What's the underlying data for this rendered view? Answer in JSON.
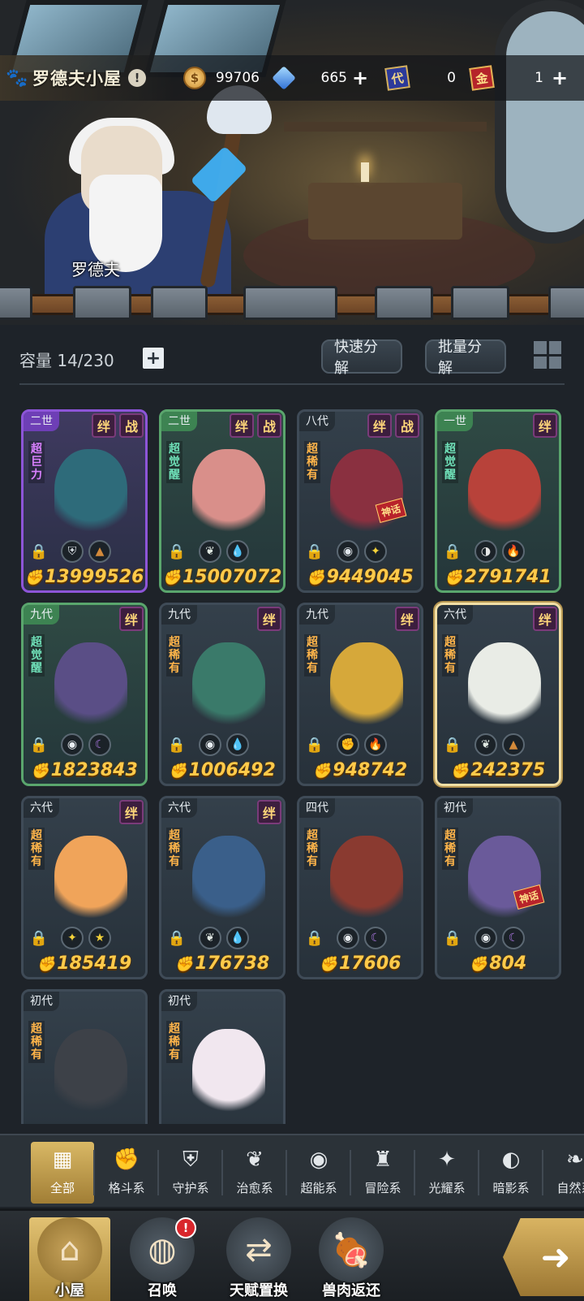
{
  "header": {
    "title": "罗德夫小屋",
    "npc_name": "罗德夫",
    "resources": [
      {
        "icon": "coin-icon",
        "value": "99706",
        "has_plus": false
      },
      {
        "icon": "crystal-icon",
        "value": "665",
        "has_plus": true
      },
      {
        "icon": "ticket-blue-icon",
        "glyph": "代",
        "value": "0",
        "has_plus": false
      },
      {
        "icon": "ticket-red-icon",
        "glyph": "金",
        "value": "1",
        "has_plus": true
      }
    ]
  },
  "inventory": {
    "capacity_label": "容量 14/230",
    "quick_decompose": "快速分解",
    "batch_decompose": "批量分解"
  },
  "cards": [
    {
      "gen": "二世",
      "rarity": "超巨力",
      "tags": [
        "绊",
        "战"
      ],
      "power": "13999526",
      "style": "purple",
      "elements": [
        "shield",
        "mountain"
      ],
      "color": "#2e6b7a"
    },
    {
      "gen": "二世",
      "rarity": "超觉醒",
      "tags": [
        "绊",
        "战"
      ],
      "power": "15007072",
      "style": "green",
      "elements": [
        "leaf",
        "water"
      ],
      "color": "#d98f8a"
    },
    {
      "gen": "八代",
      "rarity": "超稀有",
      "tags": [
        "绊",
        "战"
      ],
      "power": "9449045",
      "style": "normal",
      "elements": [
        "psychic",
        "light"
      ],
      "color": "#8a3040",
      "chip": "神话"
    },
    {
      "gen": "一世",
      "rarity": "超觉醒",
      "tags": [
        "绊"
      ],
      "power": "2791741",
      "style": "green",
      "elements": [
        "dark",
        "fire"
      ],
      "color": "#b8423a"
    },
    {
      "gen": "九代",
      "rarity": "超觉醒",
      "tags": [
        "绊"
      ],
      "power": "1823843",
      "style": "green",
      "elements": [
        "eye",
        "moon"
      ],
      "color": "#5a4e86"
    },
    {
      "gen": "九代",
      "rarity": "超稀有",
      "tags": [
        "绊"
      ],
      "power": "1006492",
      "style": "normal",
      "elements": [
        "eye",
        "water"
      ],
      "color": "#3a7a6a"
    },
    {
      "gen": "九代",
      "rarity": "超稀有",
      "tags": [
        "绊"
      ],
      "power": "948742",
      "style": "normal",
      "elements": [
        "fist",
        "fire"
      ],
      "color": "#d6a83a"
    },
    {
      "gen": "六代",
      "rarity": "超稀有",
      "tags": [
        "绊"
      ],
      "power": "242375",
      "style": "selected",
      "elements": [
        "leaf",
        "mountain"
      ],
      "color": "#e9ece6"
    },
    {
      "gen": "六代",
      "rarity": "超稀有",
      "tags": [
        "绊"
      ],
      "power": "185419",
      "style": "normal",
      "elements": [
        "light",
        "star"
      ],
      "color": "#f0a45a"
    },
    {
      "gen": "六代",
      "rarity": "超稀有",
      "tags": [
        "绊"
      ],
      "power": "176738",
      "style": "normal",
      "elements": [
        "leaf",
        "water"
      ],
      "color": "#3a5f8a"
    },
    {
      "gen": "四代",
      "rarity": "超稀有",
      "tags": [],
      "power": "17606",
      "style": "normal",
      "elements": [
        "eye",
        "moon"
      ],
      "color": "#8a3a30"
    },
    {
      "gen": "初代",
      "rarity": "超稀有",
      "tags": [],
      "power": "804",
      "style": "normal",
      "elements": [
        "eye",
        "moon"
      ],
      "color": "#6a5a9a",
      "chip": "神话"
    },
    {
      "gen": "初代",
      "rarity": "超稀有",
      "tags": [],
      "power": "",
      "style": "normal",
      "elements": [],
      "color": "#3d4148"
    },
    {
      "gen": "初代",
      "rarity": "超稀有",
      "tags": [],
      "power": "",
      "style": "normal",
      "elements": [],
      "color": "#f1e7ef"
    }
  ],
  "categories": [
    {
      "label": "全部",
      "icon": "blocks-icon",
      "glyph": "▦",
      "active": true
    },
    {
      "label": "格斗系",
      "icon": "fist-icon",
      "glyph": "✊",
      "active": false
    },
    {
      "label": "守护系",
      "icon": "shield-icon",
      "glyph": "⛨",
      "active": false
    },
    {
      "label": "治愈系",
      "icon": "sprout-icon",
      "glyph": "❦",
      "active": false
    },
    {
      "label": "超能系",
      "icon": "alien-icon",
      "glyph": "◉",
      "active": false
    },
    {
      "label": "冒险系",
      "icon": "lantern-icon",
      "glyph": "♜",
      "active": false
    },
    {
      "label": "光耀系",
      "icon": "sparkle-icon",
      "glyph": "✦",
      "active": false
    },
    {
      "label": "暗影系",
      "icon": "eye-icon",
      "glyph": "◐",
      "active": false
    },
    {
      "label": "自然系",
      "icon": "leaf-icon",
      "glyph": "❧",
      "active": false
    }
  ],
  "bottom_nav": [
    {
      "label": "小屋",
      "icon": "house-icon",
      "glyph": "⌂",
      "active": true,
      "badge": ""
    },
    {
      "label": "召唤",
      "icon": "egg-icon",
      "glyph": "◍",
      "active": false,
      "badge": "!"
    },
    {
      "label": "天赋置换",
      "icon": "swap-icon",
      "glyph": "⇄",
      "active": false,
      "badge": ""
    },
    {
      "label": "兽肉返还",
      "icon": "meat-icon",
      "glyph": "🍖",
      "active": false,
      "badge": ""
    }
  ],
  "go_button_glyph": "➜"
}
